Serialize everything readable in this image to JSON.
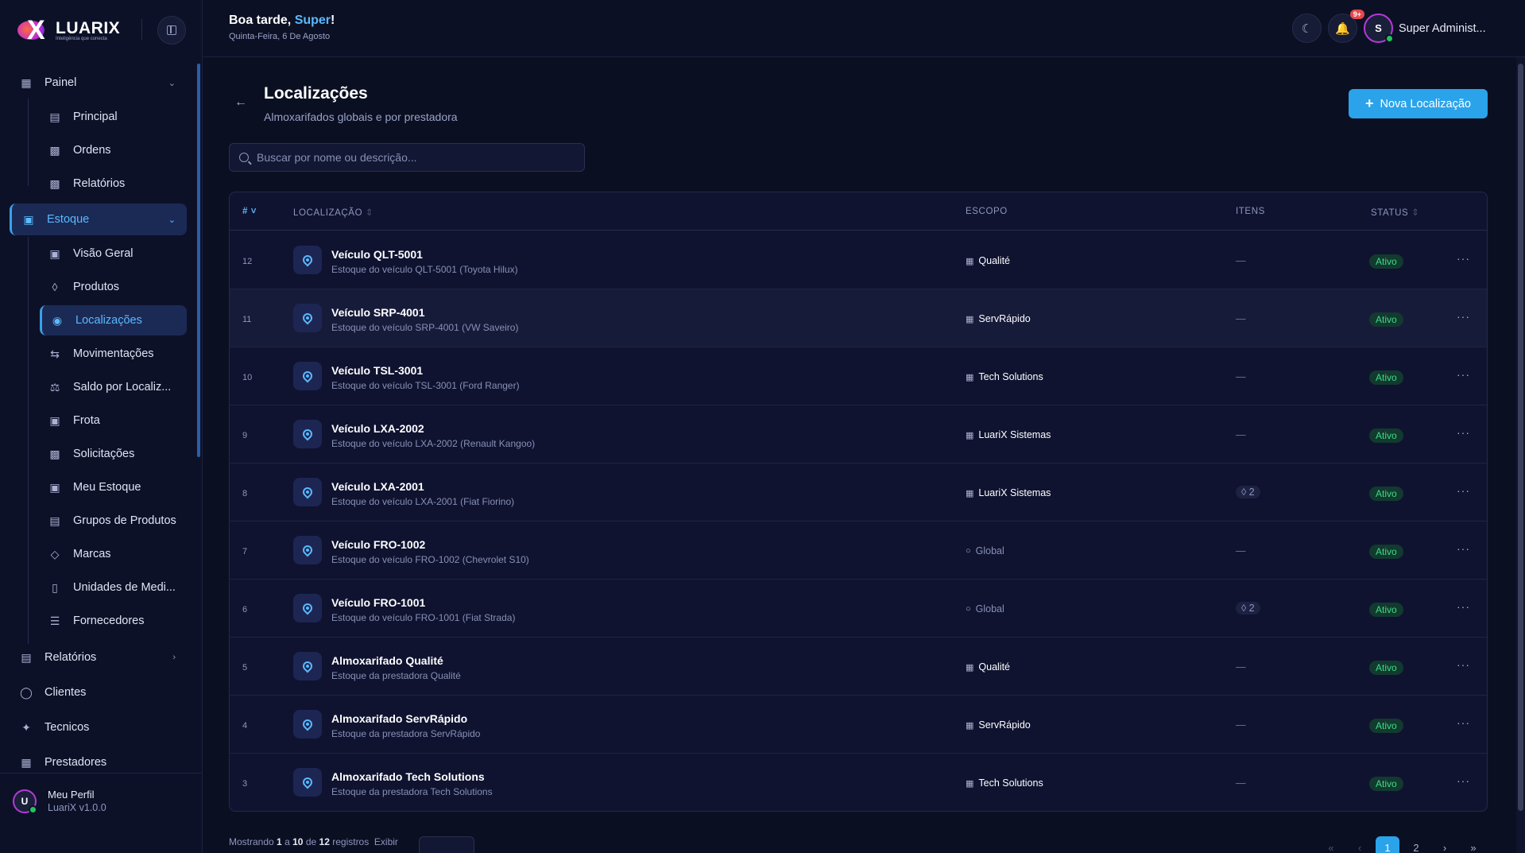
{
  "app": {
    "brand": "LUARIX",
    "tagline": "Inteligência que conecta"
  },
  "header": {
    "greeting_prefix": "Boa tarde, ",
    "greeting_name": "Super",
    "greeting_suffix": "!",
    "date": "Quinta-Feira, 6 De Agosto",
    "notifications_badge": "9+",
    "user_initial": "S",
    "user_name": "Super Administ..."
  },
  "sidebar": {
    "groups": [
      {
        "label": "Painel",
        "icon": "dashboard-icon"
      },
      {
        "label": "Estoque",
        "icon": "box-icon"
      },
      {
        "label": "Relatórios",
        "icon": "report-icon"
      },
      {
        "label": "Clientes",
        "icon": "shield-icon"
      },
      {
        "label": "Tecnicos",
        "icon": "wrench-icon"
      },
      {
        "label": "Prestadores",
        "icon": "building-icon"
      }
    ],
    "painel_items": [
      {
        "label": "Principal",
        "icon": "chart-icon"
      },
      {
        "label": "Ordens",
        "icon": "clipboard-icon"
      },
      {
        "label": "Relatórios",
        "icon": "document-icon"
      }
    ],
    "estoque_items": [
      {
        "label": "Visão Geral",
        "icon": "box-icon"
      },
      {
        "label": "Produtos",
        "icon": "boxes-icon"
      },
      {
        "label": "Localizações",
        "icon": "map-pin-icon"
      },
      {
        "label": "Movimentações",
        "icon": "arrows-icon"
      },
      {
        "label": "Saldo por Localiz...",
        "icon": "scale-icon"
      },
      {
        "label": "Frota",
        "icon": "truck-icon"
      },
      {
        "label": "Solicitações",
        "icon": "clipboard-icon"
      },
      {
        "label": "Meu Estoque",
        "icon": "box-icon"
      },
      {
        "label": "Grupos de Produtos",
        "icon": "hierarchy-icon"
      },
      {
        "label": "Marcas",
        "icon": "tag-icon"
      },
      {
        "label": "Unidades de Medi...",
        "icon": "ruler-icon"
      },
      {
        "label": "Fornecedores",
        "icon": "layers-icon"
      }
    ],
    "profile": {
      "initial": "U",
      "name": "Meu Perfil",
      "version": "LuariX v1.0.0"
    }
  },
  "page": {
    "title": "Localizações",
    "subtitle": "Almoxarifados globais e por prestadora",
    "new_button": "Nova Localização",
    "search_placeholder": "Buscar por nome ou descrição..."
  },
  "table": {
    "columns": [
      "#",
      "LOCALIZAÇÃO",
      "ESCOPO",
      "ITENS",
      "STATUS"
    ],
    "rows": [
      {
        "id": "12",
        "name": "Veículo QLT-5001",
        "desc": "Estoque do veículo QLT-5001 (Toyota Hilux)",
        "scope": "Qualité",
        "scope_type": "provider",
        "items": "—",
        "status": "Ativo"
      },
      {
        "id": "11",
        "name": "Veículo SRP-4001",
        "desc": "Estoque do veículo SRP-4001 (VW Saveiro)",
        "scope": "ServRápido",
        "scope_type": "provider",
        "items": "—",
        "status": "Ativo"
      },
      {
        "id": "10",
        "name": "Veículo TSL-3001",
        "desc": "Estoque do veículo TSL-3001 (Ford Ranger)",
        "scope": "Tech Solutions",
        "scope_type": "provider",
        "items": "—",
        "status": "Ativo"
      },
      {
        "id": "9",
        "name": "Veículo LXA-2002",
        "desc": "Estoque do veículo LXA-2002 (Renault Kangoo)",
        "scope": "LuariX Sistemas",
        "scope_type": "provider",
        "items": "—",
        "status": "Ativo"
      },
      {
        "id": "8",
        "name": "Veículo LXA-2001",
        "desc": "Estoque do veículo LXA-2001 (Fiat Fiorino)",
        "scope": "LuariX Sistemas",
        "scope_type": "provider",
        "items": "2",
        "status": "Ativo"
      },
      {
        "id": "7",
        "name": "Veículo FRO-1002",
        "desc": "Estoque do veículo FRO-1002 (Chevrolet S10)",
        "scope": "Global",
        "scope_type": "global",
        "items": "—",
        "status": "Ativo"
      },
      {
        "id": "6",
        "name": "Veículo FRO-1001",
        "desc": "Estoque do veículo FRO-1001 (Fiat Strada)",
        "scope": "Global",
        "scope_type": "global",
        "items": "2",
        "status": "Ativo"
      },
      {
        "id": "5",
        "name": "Almoxarifado Qualité",
        "desc": "Estoque da prestadora Qualité",
        "scope": "Qualité",
        "scope_type": "provider",
        "items": "—",
        "status": "Ativo"
      },
      {
        "id": "4",
        "name": "Almoxarifado ServRápido",
        "desc": "Estoque da prestadora ServRápido",
        "scope": "ServRápido",
        "scope_type": "provider",
        "items": "—",
        "status": "Ativo"
      },
      {
        "id": "3",
        "name": "Almoxarifado Tech Solutions",
        "desc": "Estoque da prestadora Tech Solutions",
        "scope": "Tech Solutions",
        "scope_type": "provider",
        "items": "—",
        "status": "Ativo"
      }
    ]
  },
  "footer": {
    "showing_prefix": "Mostrando",
    "from": "1",
    "a": "a",
    "to": "10",
    "de": "de",
    "total": "12",
    "registros": "registros",
    "exibir": "Exibir",
    "pages": [
      "1",
      "2"
    ],
    "current_page": "1"
  },
  "colors": {
    "accent": "#2aa3ea",
    "active_nav": "#5ab9ff",
    "status_green": "#3ddc84",
    "badge_red": "#e5484d"
  }
}
